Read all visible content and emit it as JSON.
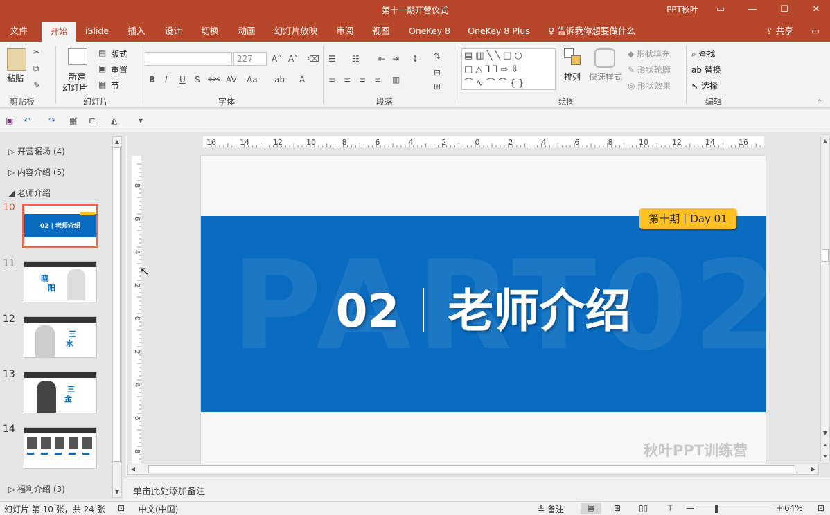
{
  "window": {
    "title": "第十一期开营仪式",
    "user": "PPT秋叶"
  },
  "tabs": [
    {
      "label": "文件"
    },
    {
      "label": "开始"
    },
    {
      "label": "iSlide"
    },
    {
      "label": "插入"
    },
    {
      "label": "设计"
    },
    {
      "label": "切换"
    },
    {
      "label": "动画"
    },
    {
      "label": "幻灯片放映"
    },
    {
      "label": "审阅"
    },
    {
      "label": "视图"
    },
    {
      "label": "OneKey 8"
    },
    {
      "label": "OneKey 8 Plus"
    }
  ],
  "tellme": "告诉我你想要做什么",
  "share": "共享",
  "ribbon": {
    "clipboard": {
      "paste": "粘贴",
      "label": "剪贴板"
    },
    "slides": {
      "new_slide": "新建",
      "new_slide2": "幻灯片",
      "layout": "版式",
      "reset": "重置",
      "section": "节",
      "label": "幻灯片"
    },
    "font": {
      "font_name": "",
      "font_size": "227",
      "label": "字体"
    },
    "paragraph": {
      "label": "段落"
    },
    "drawing": {
      "arrange": "排列",
      "quick_styles": "快速样式",
      "fill": "形状填充",
      "outline": "形状轮廓",
      "effects": "形状效果",
      "label": "绘图"
    },
    "editing": {
      "find": "查找",
      "replace": "替换",
      "select": "选择",
      "label": "编辑"
    }
  },
  "sections": [
    {
      "label": "开营暖场 (4)"
    },
    {
      "label": "内容介绍 (5)"
    },
    {
      "label": "老师介绍"
    },
    {
      "label": "福利介绍 (3)"
    }
  ],
  "slides": [
    {
      "num": "10"
    },
    {
      "num": "11"
    },
    {
      "num": "12"
    },
    {
      "num": "13"
    },
    {
      "num": "14"
    }
  ],
  "slide": {
    "watermark_text": "PART02",
    "number": "02",
    "title": "老师介绍",
    "badge": "第十期丨Day 01",
    "brand": "秋叶PPT训练营"
  },
  "ruler": {
    "h_ticks": [
      "16",
      "14",
      "12",
      "10",
      "8",
      "6",
      "4",
      "2",
      "0",
      "2",
      "4",
      "6",
      "8",
      "10",
      "12",
      "14",
      "16"
    ],
    "v_ticks": [
      "8",
      "6",
      "4",
      "2",
      "0",
      "2",
      "4",
      "6",
      "8"
    ]
  },
  "notes": {
    "placeholder": "单击此处添加备注"
  },
  "status": {
    "slide_info": "幻灯片 第 10 张，共 24 张",
    "language": "中文(中国)",
    "notes_btn": "备注",
    "zoom": "64%"
  },
  "colors": {
    "accent": "#b7472a",
    "slide_blue": "#0a6cc0",
    "badge_yellow": "#ffc222"
  }
}
